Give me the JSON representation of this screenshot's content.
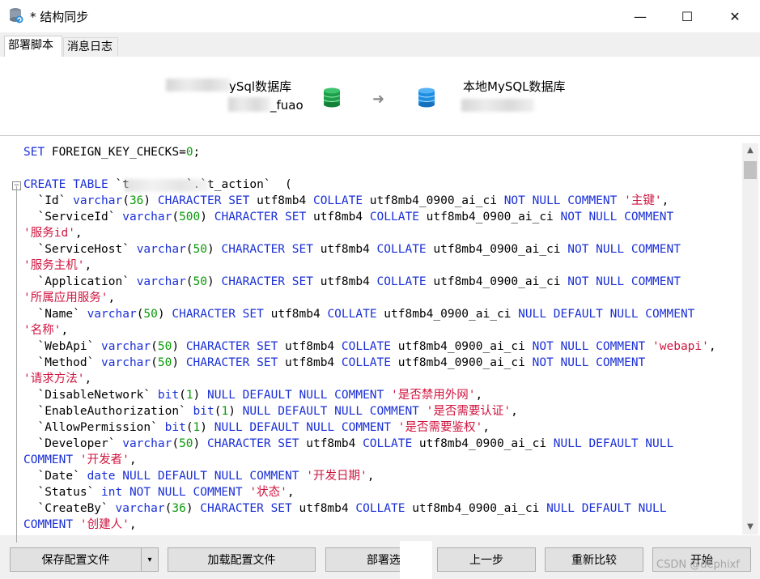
{
  "window": {
    "title": "* 结构同步",
    "minimize_label": "—",
    "maximize_label": "☐",
    "close_label": "✕"
  },
  "tabs": [
    {
      "label": "部署脚本",
      "active": true
    },
    {
      "label": "消息日志",
      "active": false
    }
  ],
  "sync": {
    "source_name": "ySql数据库",
    "source_db": "_fuao",
    "arrow_icon": "arrow-right-icon",
    "target_name": "本地MySQL数据库",
    "source_icon_color": "#1e9e4a",
    "target_icon_color": "#1f8de0"
  },
  "colors": {
    "keyword": "#1a2fd6",
    "number": "#0a9a0a",
    "string": "#d0153f"
  },
  "code": {
    "lines": [
      [
        [
          "k",
          "SET"
        ],
        [
          "p",
          " FOREIGN_KEY_CHECKS="
        ],
        [
          "n",
          "0"
        ],
        [
          "p",
          ";"
        ]
      ],
      [],
      [
        [
          "k",
          "CREATE TABLE"
        ],
        [
          "p",
          " `t"
        ],
        [
          "p",
          "        "
        ],
        [
          "p",
          "`.`t_action`  ("
        ]
      ],
      [
        [
          "p",
          "  `Id` "
        ],
        [
          "k",
          "varchar"
        ],
        [
          "p",
          "("
        ],
        [
          "n",
          "36"
        ],
        [
          "p",
          ") "
        ],
        [
          "k",
          "CHARACTER SET"
        ],
        [
          "p",
          " utf8mb4 "
        ],
        [
          "k",
          "COLLATE"
        ],
        [
          "p",
          " utf8mb4_0900_ai_ci "
        ],
        [
          "k",
          "NOT NULL COMMENT"
        ],
        [
          "p",
          " "
        ],
        [
          "s",
          "'主键'"
        ],
        [
          "p",
          ","
        ]
      ],
      [
        [
          "p",
          "  `ServiceId` "
        ],
        [
          "k",
          "varchar"
        ],
        [
          "p",
          "("
        ],
        [
          "n",
          "500"
        ],
        [
          "p",
          ") "
        ],
        [
          "k",
          "CHARACTER SET"
        ],
        [
          "p",
          " utf8mb4 "
        ],
        [
          "k",
          "COLLATE"
        ],
        [
          "p",
          " utf8mb4_0900_ai_ci "
        ],
        [
          "k",
          "NOT NULL COMMENT"
        ]
      ],
      [
        [
          "s",
          "'服务id'"
        ],
        [
          "p",
          ","
        ]
      ],
      [
        [
          "p",
          "  `ServiceHost` "
        ],
        [
          "k",
          "varchar"
        ],
        [
          "p",
          "("
        ],
        [
          "n",
          "50"
        ],
        [
          "p",
          ") "
        ],
        [
          "k",
          "CHARACTER SET"
        ],
        [
          "p",
          " utf8mb4 "
        ],
        [
          "k",
          "COLLATE"
        ],
        [
          "p",
          " utf8mb4_0900_ai_ci "
        ],
        [
          "k",
          "NOT NULL COMMENT"
        ]
      ],
      [
        [
          "s",
          "'服务主机'"
        ],
        [
          "p",
          ","
        ]
      ],
      [
        [
          "p",
          "  `Application` "
        ],
        [
          "k",
          "varchar"
        ],
        [
          "p",
          "("
        ],
        [
          "n",
          "50"
        ],
        [
          "p",
          ") "
        ],
        [
          "k",
          "CHARACTER SET"
        ],
        [
          "p",
          " utf8mb4 "
        ],
        [
          "k",
          "COLLATE"
        ],
        [
          "p",
          " utf8mb4_0900_ai_ci "
        ],
        [
          "k",
          "NOT NULL COMMENT"
        ]
      ],
      [
        [
          "s",
          "'所属应用服务'"
        ],
        [
          "p",
          ","
        ]
      ],
      [
        [
          "p",
          "  `Name` "
        ],
        [
          "k",
          "varchar"
        ],
        [
          "p",
          "("
        ],
        [
          "n",
          "50"
        ],
        [
          "p",
          ") "
        ],
        [
          "k",
          "CHARACTER SET"
        ],
        [
          "p",
          " utf8mb4 "
        ],
        [
          "k",
          "COLLATE"
        ],
        [
          "p",
          " utf8mb4_0900_ai_ci "
        ],
        [
          "k",
          "NULL DEFAULT NULL COMMENT"
        ]
      ],
      [
        [
          "s",
          "'名称'"
        ],
        [
          "p",
          ","
        ]
      ],
      [
        [
          "p",
          "  `WebApi` "
        ],
        [
          "k",
          "varchar"
        ],
        [
          "p",
          "("
        ],
        [
          "n",
          "50"
        ],
        [
          "p",
          ") "
        ],
        [
          "k",
          "CHARACTER SET"
        ],
        [
          "p",
          " utf8mb4 "
        ],
        [
          "k",
          "COLLATE"
        ],
        [
          "p",
          " utf8mb4_0900_ai_ci "
        ],
        [
          "k",
          "NOT NULL COMMENT"
        ],
        [
          "p",
          " "
        ],
        [
          "s",
          "'webapi'"
        ],
        [
          "p",
          ","
        ]
      ],
      [
        [
          "p",
          "  `Method` "
        ],
        [
          "k",
          "varchar"
        ],
        [
          "p",
          "("
        ],
        [
          "n",
          "50"
        ],
        [
          "p",
          ") "
        ],
        [
          "k",
          "CHARACTER SET"
        ],
        [
          "p",
          " utf8mb4 "
        ],
        [
          "k",
          "COLLATE"
        ],
        [
          "p",
          " utf8mb4_0900_ai_ci "
        ],
        [
          "k",
          "NOT NULL COMMENT"
        ]
      ],
      [
        [
          "s",
          "'请求方法'"
        ],
        [
          "p",
          ","
        ]
      ],
      [
        [
          "p",
          "  `DisableNetwork` "
        ],
        [
          "k",
          "bit"
        ],
        [
          "p",
          "("
        ],
        [
          "n",
          "1"
        ],
        [
          "p",
          ") "
        ],
        [
          "k",
          "NULL DEFAULT NULL COMMENT"
        ],
        [
          "p",
          " "
        ],
        [
          "s",
          "'是否禁用外网'"
        ],
        [
          "p",
          ","
        ]
      ],
      [
        [
          "p",
          "  `EnableAuthorization` "
        ],
        [
          "k",
          "bit"
        ],
        [
          "p",
          "("
        ],
        [
          "n",
          "1"
        ],
        [
          "p",
          ") "
        ],
        [
          "k",
          "NULL DEFAULT NULL COMMENT"
        ],
        [
          "p",
          " "
        ],
        [
          "s",
          "'是否需要认证'"
        ],
        [
          "p",
          ","
        ]
      ],
      [
        [
          "p",
          "  `AllowPermission` "
        ],
        [
          "k",
          "bit"
        ],
        [
          "p",
          "("
        ],
        [
          "n",
          "1"
        ],
        [
          "p",
          ") "
        ],
        [
          "k",
          "NULL DEFAULT NULL COMMENT"
        ],
        [
          "p",
          " "
        ],
        [
          "s",
          "'是否需要鉴权'"
        ],
        [
          "p",
          ","
        ]
      ],
      [
        [
          "p",
          "  `Developer` "
        ],
        [
          "k",
          "varchar"
        ],
        [
          "p",
          "("
        ],
        [
          "n",
          "50"
        ],
        [
          "p",
          ") "
        ],
        [
          "k",
          "CHARACTER SET"
        ],
        [
          "p",
          " utf8mb4 "
        ],
        [
          "k",
          "COLLATE"
        ],
        [
          "p",
          " utf8mb4_0900_ai_ci "
        ],
        [
          "k",
          "NULL DEFAULT NULL"
        ]
      ],
      [
        [
          "k",
          "COMMENT"
        ],
        [
          "p",
          " "
        ],
        [
          "s",
          "'开发者'"
        ],
        [
          "p",
          ","
        ]
      ],
      [
        [
          "p",
          "  `Date` "
        ],
        [
          "k",
          "date NULL DEFAULT NULL COMMENT"
        ],
        [
          "p",
          " "
        ],
        [
          "s",
          "'开发日期'"
        ],
        [
          "p",
          ","
        ]
      ],
      [
        [
          "p",
          "  `Status` "
        ],
        [
          "k",
          "int NOT NULL COMMENT"
        ],
        [
          "p",
          " "
        ],
        [
          "s",
          "'状态'"
        ],
        [
          "p",
          ","
        ]
      ],
      [
        [
          "p",
          "  `CreateBy` "
        ],
        [
          "k",
          "varchar"
        ],
        [
          "p",
          "("
        ],
        [
          "n",
          "36"
        ],
        [
          "p",
          ") "
        ],
        [
          "k",
          "CHARACTER SET"
        ],
        [
          "p",
          " utf8mb4 "
        ],
        [
          "k",
          "COLLATE"
        ],
        [
          "p",
          " utf8mb4_0900_ai_ci "
        ],
        [
          "k",
          "NULL DEFAULT NULL"
        ]
      ],
      [
        [
          "k",
          "COMMENT"
        ],
        [
          "p",
          " "
        ],
        [
          "s",
          "'创建人'"
        ],
        [
          "p",
          ","
        ]
      ]
    ]
  },
  "buttons": {
    "save_config": "保存配置文件",
    "save_dropdown_icon": "▾",
    "load_config": "加载配置文件",
    "deploy": "部署选",
    "previous": "上一步",
    "recompare": "重新比较",
    "start": "开始"
  },
  "watermark": "CSDN @dephixf"
}
